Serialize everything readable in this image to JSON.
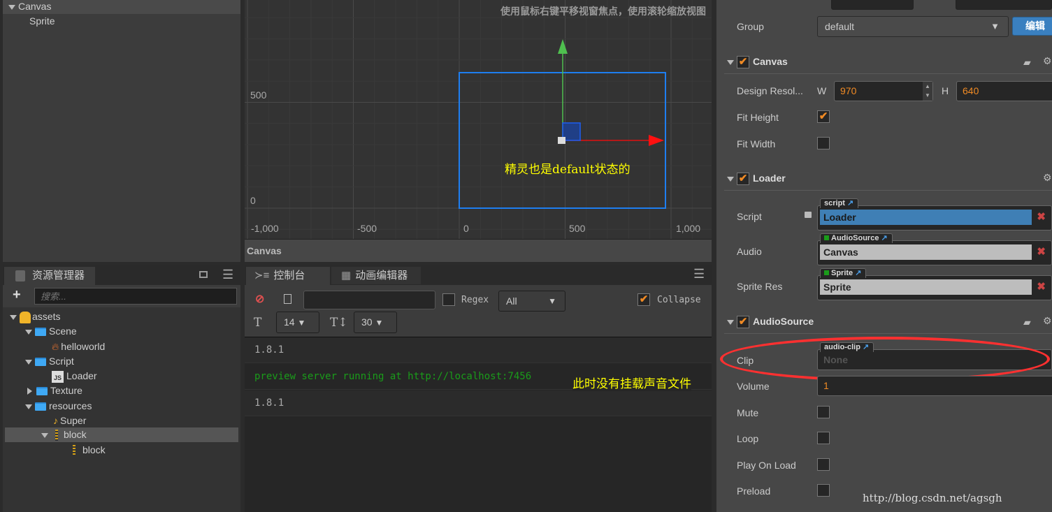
{
  "hierarchy": {
    "items": [
      {
        "label": "Canvas",
        "expanded": true
      },
      {
        "label": "Sprite"
      }
    ]
  },
  "assets": {
    "title": "资源管理器",
    "search_placeholder": "搜索...",
    "tree": [
      {
        "label": "assets",
        "icon": "assets-db-icon"
      },
      {
        "label": "Scene",
        "icon": "folder-icon"
      },
      {
        "label": "helloworld",
        "icon": "scene-fire-icon"
      },
      {
        "label": "Script",
        "icon": "folder-icon"
      },
      {
        "label": "Loader",
        "icon": "js-file-icon"
      },
      {
        "label": "Texture",
        "icon": "folder-icon"
      },
      {
        "label": "resources",
        "icon": "folder-icon"
      },
      {
        "label": "Super",
        "icon": "audio-note-icon"
      },
      {
        "label": "block",
        "icon": "atlas-icon",
        "selected": true
      },
      {
        "label": "block",
        "icon": "atlas-icon"
      }
    ]
  },
  "scene": {
    "hint": "使用鼠标右键平移视窗焦点，使用滚轮缩放视图",
    "x_ticks": [
      "-1,000",
      "-500",
      "0",
      "500",
      "1,000"
    ],
    "y_ticks": [
      "500",
      "0"
    ],
    "annotation": "精灵也是default状态的",
    "footer": "Canvas"
  },
  "console": {
    "tabs": [
      {
        "label": "控制台",
        "active": true
      },
      {
        "label": "动画编辑器"
      }
    ],
    "regex_label": "Regex",
    "regex_checked": false,
    "filter_value": "All",
    "collapse_label": "Collapse",
    "collapse_checked": true,
    "font_size": "14",
    "line_height": "30",
    "logs": [
      {
        "text": "1.8.1",
        "color": "#aaaaaa"
      },
      {
        "text": "preview server running at http://localhost:7456",
        "color": "#1a9c1a"
      },
      {
        "text": "1.8.1",
        "color": "#aaaaaa"
      }
    ],
    "annotation": "此时没有挂载声音文件"
  },
  "inspector": {
    "group_label": "Group",
    "group_value": "default",
    "edit_button": "编辑",
    "canvas": {
      "title": "Canvas",
      "enabled": true,
      "design_res_label": "Design Resol...",
      "w_label": "W",
      "w": "970",
      "h_label": "H",
      "h": "640",
      "fit_height_label": "Fit Height",
      "fit_height": true,
      "fit_width_label": "Fit Width",
      "fit_width": false
    },
    "loader": {
      "title": "Loader",
      "enabled": true,
      "script_label": "Script",
      "script_tag": "script",
      "script_value": "Loader",
      "audio_label": "Audio",
      "audio_tag": "AudioSource",
      "audio_value": "Canvas",
      "sprite_label": "Sprite Res",
      "sprite_tag": "Sprite",
      "sprite_value": "Sprite"
    },
    "audiosource": {
      "title": "AudioSource",
      "enabled": true,
      "clip_label": "Clip",
      "clip_tag": "audio-clip",
      "clip_value": "None",
      "volume_label": "Volume",
      "volume": "1",
      "mute_label": "Mute",
      "mute": false,
      "loop_label": "Loop",
      "loop": false,
      "play_on_load_label": "Play On Load",
      "play_on_load": false,
      "preload_label": "Preload",
      "preload": false
    }
  },
  "watermark": "http://blog.csdn.net/agsgh",
  "colors": {
    "accent": "#f08a24",
    "link": "#4a9ee8",
    "highlight_circle": "#ff3030",
    "annotation": "#ffff00"
  }
}
